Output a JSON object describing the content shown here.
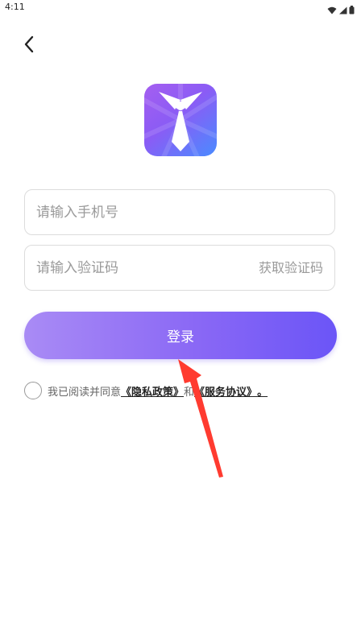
{
  "status_bar": {
    "time": "4:11",
    "icons": [
      "wifi-icon",
      "signal-icon",
      "battery-icon"
    ]
  },
  "header": {
    "back_icon": "chevron-left-icon"
  },
  "logo": {
    "icon": "necktie-icon",
    "colors": [
      "#a55ef0",
      "#8a5cf5",
      "#4a8bff"
    ]
  },
  "form": {
    "phone_placeholder": "请输入手机号",
    "phone_value": "",
    "code_placeholder": "请输入验证码",
    "code_value": "",
    "get_code_label": "获取验证码",
    "login_label": "登录"
  },
  "agreement": {
    "prefix": "我已阅读并同意",
    "privacy_link": "《隐私政策》",
    "conjunction": "和",
    "service_link": "《服务协议》",
    "suffix": "。",
    "checked": false
  },
  "colors": {
    "accent_start": "#a98bf5",
    "accent_end": "#6b55f7",
    "annotation_arrow": "#ff3b30"
  }
}
